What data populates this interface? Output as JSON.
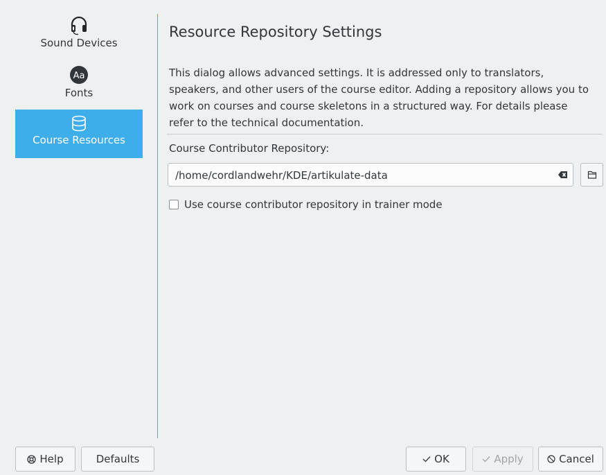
{
  "sidebar": {
    "items": [
      {
        "label": "Sound Devices",
        "icon": "headset-icon"
      },
      {
        "label": "Fonts",
        "icon": "fonts-icon",
        "icon_text": "Aa"
      },
      {
        "label": "Course Resources",
        "icon": "database-icon",
        "selected": true
      }
    ]
  },
  "main": {
    "title": "Resource Repository Settings",
    "description": "This dialog allows advanced settings. It is addressed only to translators, speakers, and other users of the course editor. Adding a repository allows you to work on courses and course skeletons in a structured way. For details please refer to the technical documentation.",
    "repository_label": "Course Contributor Repository:",
    "repository_path": "/home/cordlandwehr/KDE/artikulate-data",
    "trainer_mode_label": "Use course contributor repository in trainer mode",
    "trainer_mode_checked": false
  },
  "buttons": {
    "help": "Help",
    "defaults": "Defaults",
    "ok": "OK",
    "apply": "Apply",
    "cancel": "Cancel"
  },
  "colors": {
    "accent": "#3daee9",
    "background": "#eff0f1",
    "text": "#31363b",
    "disabled_text": "#a0a4a8"
  }
}
